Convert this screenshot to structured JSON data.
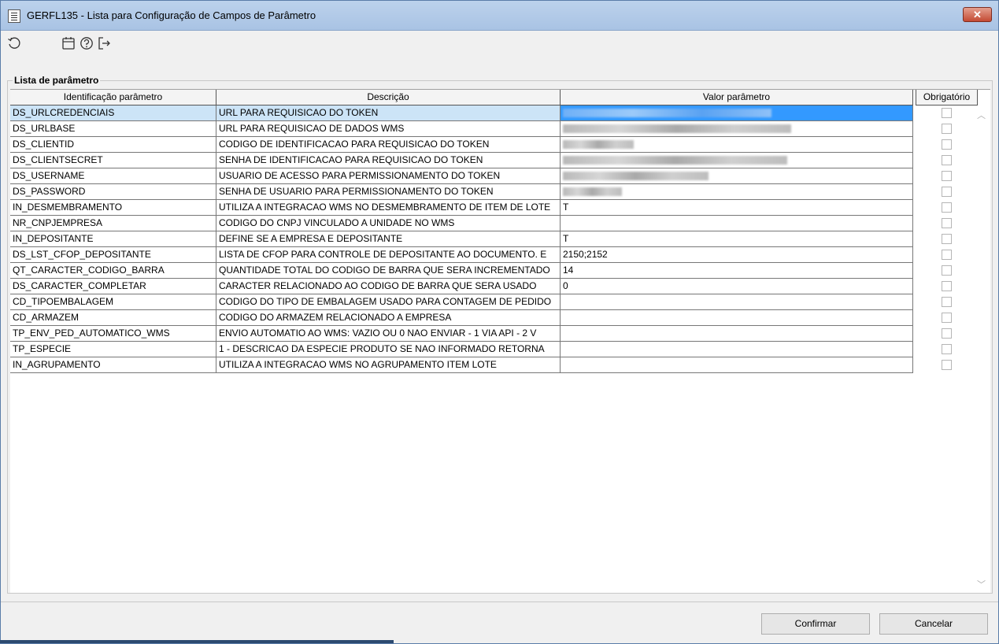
{
  "window": {
    "title": "GERFL135 - Lista para Configuração de Campos de Parâmetro",
    "close_label": "✕"
  },
  "toolbar": {
    "icons": [
      "refresh-icon",
      "calendar-icon",
      "help-icon",
      "exit-icon"
    ]
  },
  "group": {
    "label": "Lista de parâmetro"
  },
  "table": {
    "headers": [
      "Identificação parâmetro",
      "Descrição",
      "Valor parâmetro",
      "Obrigatório"
    ],
    "rows": [
      {
        "id": "DS_URLCREDENCIAIS",
        "desc": "URL PARA REQUISICAO DO TOKEN",
        "value": "",
        "redacted": true
      },
      {
        "id": "DS_URLBASE",
        "desc": "URL PARA REQUISICAO DE DADOS WMS",
        "value": "",
        "redacted": true
      },
      {
        "id": "DS_CLIENTID",
        "desc": "CODIGO DE IDENTIFICACAO PARA REQUISICAO DO TOKEN",
        "value": "",
        "redacted": true
      },
      {
        "id": "DS_CLIENTSECRET",
        "desc": "SENHA DE IDENTIFICACAO PARA REQUISICAO DO TOKEN",
        "value": "",
        "redacted": true
      },
      {
        "id": "DS_USERNAME",
        "desc": "USUARIO DE ACESSO PARA PERMISSIONAMENTO DO TOKEN",
        "value": "",
        "redacted": true
      },
      {
        "id": "DS_PASSWORD",
        "desc": "SENHA DE USUARIO PARA PERMISSIONAMENTO DO TOKEN",
        "value": "",
        "redacted": true
      },
      {
        "id": "IN_DESMEMBRAMENTO",
        "desc": "UTILIZA A INTEGRACAO WMS NO DESMEMBRAMENTO DE ITEM DE LOTE",
        "value": "T"
      },
      {
        "id": "NR_CNPJEMPRESA",
        "desc": "CODIGO DO CNPJ VINCULADO A UNIDADE NO WMS",
        "value": ""
      },
      {
        "id": "IN_DEPOSITANTE",
        "desc": "DEFINE SE A EMPRESA E DEPOSITANTE",
        "value": "T"
      },
      {
        "id": "DS_LST_CFOP_DEPOSITANTE",
        "desc": "LISTA DE CFOP PARA CONTROLE DE DEPOSITANTE AO DOCUMENTO. E",
        "value": "2150;2152"
      },
      {
        "id": "QT_CARACTER_CODIGO_BARRA",
        "desc": "QUANTIDADE TOTAL DO CODIGO DE BARRA QUE SERA INCREMENTADO",
        "value": "14"
      },
      {
        "id": "DS_CARACTER_COMPLETAR",
        "desc": "CARACTER RELACIONADO AO CODIGO DE BARRA QUE SERA USADO",
        "value": "0"
      },
      {
        "id": "CD_TIPOEMBALAGEM",
        "desc": "CODIGO DO TIPO DE EMBALAGEM USADO PARA CONTAGEM DE PEDIDO",
        "value": ""
      },
      {
        "id": "CD_ARMAZEM",
        "desc": "CODIGO DO ARMAZEM RELACIONADO A EMPRESA",
        "value": ""
      },
      {
        "id": "TP_ENV_PED_AUTOMATICO_WMS",
        "desc": "ENVIO AUTOMATIO AO WMS: VAZIO OU 0 NAO ENVIAR - 1 VIA API - 2 V",
        "value": ""
      },
      {
        "id": "TP_ESPECIE",
        "desc": "1 - DESCRICAO DA ESPECIE PRODUTO SE NAO INFORMADO RETORNA",
        "value": ""
      },
      {
        "id": "IN_AGRUPAMENTO",
        "desc": "UTILIZA A INTEGRACAO WMS NO AGRUPAMENTO ITEM LOTE",
        "value": ""
      }
    ]
  },
  "buttons": {
    "confirm": "Confirmar",
    "cancel": "Cancelar"
  }
}
